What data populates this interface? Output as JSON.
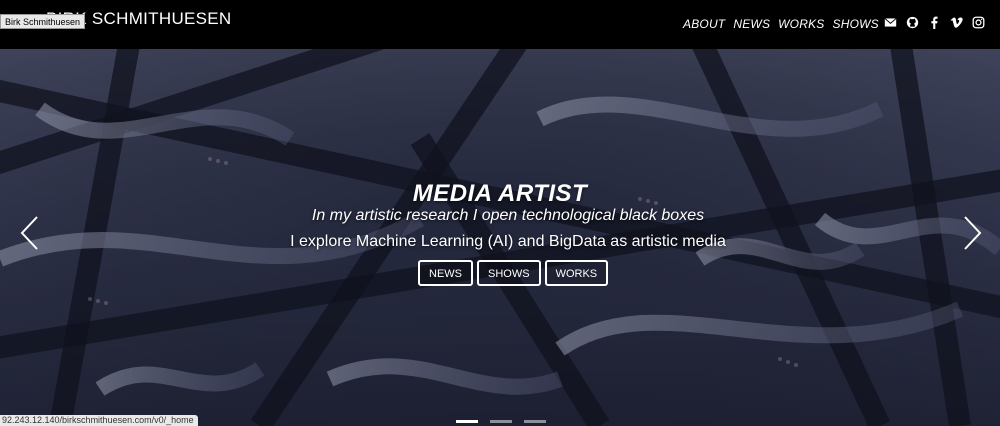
{
  "header": {
    "brand": "BIRK SCHMITHUESEN",
    "tooltip": "Birk Schmithuesen",
    "nav": [
      "ABOUT",
      "NEWS",
      "WORKS",
      "SHOWS"
    ],
    "social_icons": [
      "envelope-icon",
      "github-icon",
      "facebook-icon",
      "vimeo-icon",
      "instagram-icon"
    ]
  },
  "hero": {
    "title": "MEDIA ARTIST",
    "line1": "In my artistic research I open technological black boxes",
    "line2": "I explore Machine Learning (AI) and BigData as artistic media",
    "buttons": [
      "NEWS",
      "SHOWS",
      "WORKS"
    ],
    "slides": 3,
    "active_slide": 1
  },
  "status_bar": {
    "url": "92.243.12.140/birkschmithuesen.com/v0/_home"
  },
  "colors": {
    "header_bg": "#000000",
    "text": "#ffffff",
    "hero_tint": "#3a3e55"
  }
}
